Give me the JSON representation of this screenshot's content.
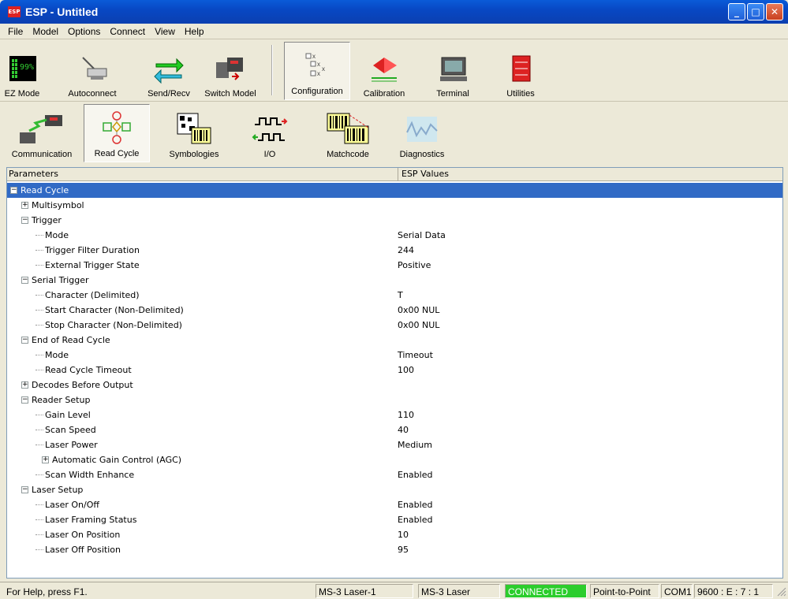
{
  "window": {
    "title": "ESP - Untitled",
    "app_icon_text": "ESP",
    "minimize": "_",
    "maximize": "□",
    "close": "✕"
  },
  "menu": [
    "File",
    "Model",
    "Options",
    "Connect",
    "View",
    "Help"
  ],
  "toolbar_main": {
    "ez_mode": "EZ Mode",
    "ez_mode_display": "99%",
    "autoconnect": "Autoconnect",
    "send_recv": "Send/Recv",
    "switch_model": "Switch Model",
    "configuration": "Configuration",
    "calibration": "Calibration",
    "terminal": "Terminal",
    "utilities": "Utilities"
  },
  "toolbar_config": {
    "communication": "Communication",
    "read_cycle": "Read Cycle",
    "symbologies": "Symbologies",
    "io": "I/O",
    "matchcode": "Matchcode",
    "diagnostics": "Diagnostics"
  },
  "grid": {
    "col_params": "Parameters",
    "col_values": "ESP Values",
    "rows": [
      {
        "label": "Read Cycle",
        "value": "",
        "level": 0,
        "expander": "−",
        "selected": true
      },
      {
        "label": "Multisymbol",
        "value": "",
        "level": 1,
        "expander": "+"
      },
      {
        "label": "Trigger",
        "value": "",
        "level": 1,
        "expander": "−"
      },
      {
        "label": "Mode",
        "value": "Serial Data",
        "level": 2
      },
      {
        "label": "Trigger Filter Duration",
        "value": "244",
        "level": 2
      },
      {
        "label": "External Trigger State",
        "value": "Positive",
        "level": 2
      },
      {
        "label": "Serial Trigger",
        "value": "",
        "level": 1,
        "expander": "−"
      },
      {
        "label": "Character (Delimited)",
        "value": "T",
        "level": 2
      },
      {
        "label": "Start Character (Non-Delimited)",
        "value": "0x00   NUL",
        "level": 2
      },
      {
        "label": "Stop Character (Non-Delimited)",
        "value": "0x00   NUL",
        "level": 2
      },
      {
        "label": "End of Read Cycle",
        "value": "",
        "level": 1,
        "expander": "−"
      },
      {
        "label": "Mode",
        "value": "Timeout",
        "level": 2
      },
      {
        "label": "Read Cycle Timeout",
        "value": "100",
        "level": 2
      },
      {
        "label": "Decodes Before Output",
        "value": "",
        "level": 1,
        "expander": "+"
      },
      {
        "label": "Reader Setup",
        "value": "",
        "level": 1,
        "expander": "−"
      },
      {
        "label": "Gain Level",
        "value": "110",
        "level": 2
      },
      {
        "label": "Scan Speed",
        "value": "40",
        "level": 2
      },
      {
        "label": "Laser Power",
        "value": "Medium",
        "level": 2
      },
      {
        "label": "Automatic Gain Control (AGC)",
        "value": "",
        "level": 2,
        "expander": "+"
      },
      {
        "label": "Scan Width Enhance",
        "value": "Enabled",
        "level": 2
      },
      {
        "label": "Laser Setup",
        "value": "",
        "level": 1,
        "expander": "−"
      },
      {
        "label": "Laser On/Off",
        "value": "Enabled",
        "level": 2
      },
      {
        "label": "Laser Framing Status",
        "value": "Enabled",
        "level": 2
      },
      {
        "label": "Laser On Position",
        "value": "10",
        "level": 2
      },
      {
        "label": "Laser Off Position",
        "value": "95",
        "level": 2
      }
    ]
  },
  "status": {
    "help": "For Help, press F1.",
    "device": "MS-3 Laser-1",
    "model": "MS-3 Laser",
    "connection": "CONNECTED",
    "mode": "Point-to-Point",
    "port": "COM1",
    "settings": "9600 : E : 7 : 1"
  },
  "colors": {
    "selection": "#316ac5",
    "connected": "#2ccd2c",
    "titlebar": "#0a5bd8"
  }
}
